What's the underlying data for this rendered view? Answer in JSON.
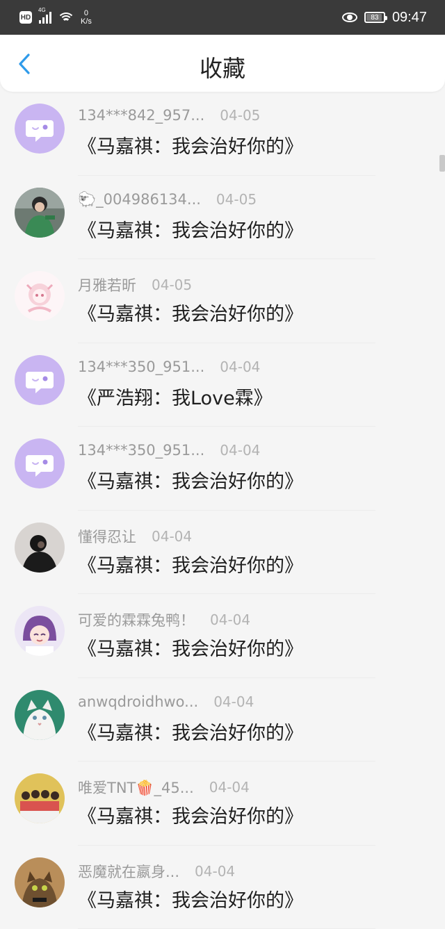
{
  "status_bar": {
    "hd": "HD",
    "network": "4G",
    "speed_value": "0",
    "speed_unit": "K/s",
    "battery": "83",
    "time": "09:47"
  },
  "header": {
    "title": "收藏"
  },
  "items": [
    {
      "name": "134***842_957...",
      "date": "04-05",
      "content": "《马嘉祺：我会治好你的》",
      "avatar": "chat-bubble"
    },
    {
      "name": "🐑_004986134...",
      "date": "04-05",
      "content": "《马嘉祺：我会治好你的》",
      "avatar": "photo-person"
    },
    {
      "name": "月雅若昕",
      "date": "04-05",
      "content": "《马嘉祺：我会治好你的》",
      "avatar": "anime-pink"
    },
    {
      "name": "134***350_951...",
      "date": "04-04",
      "content": "《严浩翔：我Love霖》",
      "avatar": "chat-bubble"
    },
    {
      "name": "134***350_951...",
      "date": "04-04",
      "content": "《马嘉祺：我会治好你的》",
      "avatar": "chat-bubble"
    },
    {
      "name": "懂得忍让",
      "date": "04-04",
      "content": "《马嘉祺：我会治好你的》",
      "avatar": "photo-dark"
    },
    {
      "name": "可爱的霖霖兔鸭！",
      "date": "04-04",
      "content": "《马嘉祺：我会治好你的》",
      "avatar": "anime-purple"
    },
    {
      "name": "anwqdroidhwo...",
      "date": "04-04",
      "content": "《马嘉祺：我会治好你的》",
      "avatar": "photo-cat-white"
    },
    {
      "name": "唯爱TNT🍿_45...",
      "date": "04-04",
      "content": "《马嘉祺：我会治好你的》",
      "avatar": "photo-group"
    },
    {
      "name": "恶魔就在嬴身...",
      "date": "04-04",
      "content": "《马嘉祺：我会治好你的》",
      "avatar": "photo-kitten"
    }
  ],
  "colors": {
    "accent": "#2f9bea",
    "chat_avatar_bg": "#c9b5f2",
    "status_bar_bg": "#3a3a3a"
  }
}
